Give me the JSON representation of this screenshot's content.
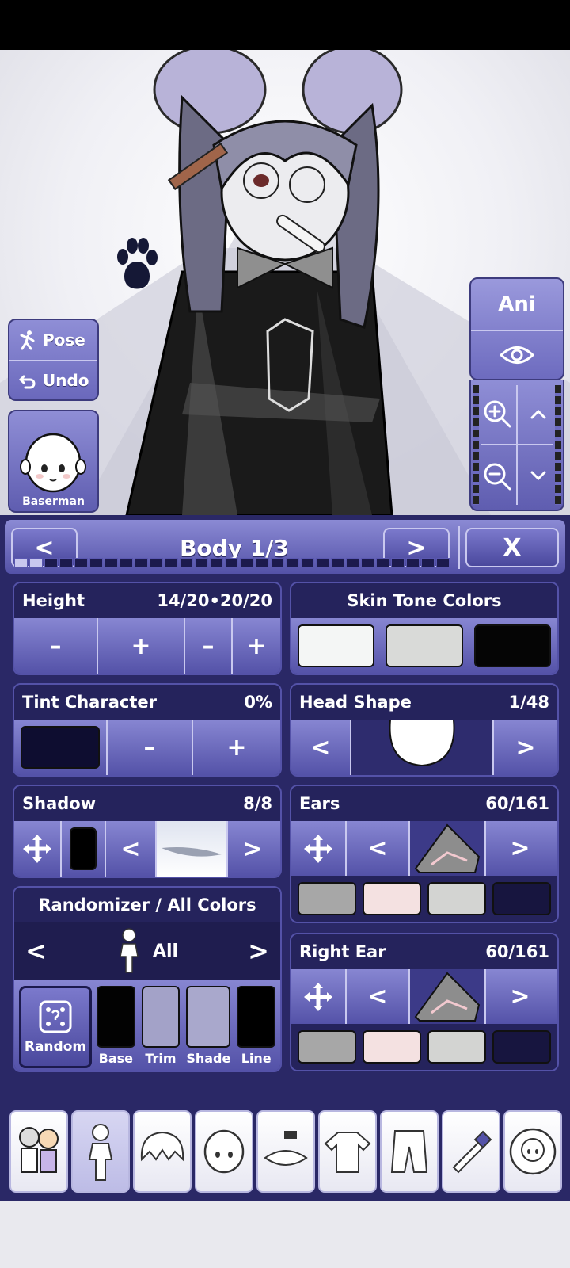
{
  "scene": {
    "pose_label": "Pose",
    "undo_label": "Undo",
    "preset_name": "Baserman",
    "ani_label": "Ani"
  },
  "panel": {
    "prev_label": "<",
    "title": "Body 1/3",
    "next_label": ">",
    "close_label": "X",
    "progress_total": 29,
    "progress_active": 2
  },
  "height": {
    "label": "Height",
    "value": "14/20•20/20",
    "minus": "–",
    "plus": "+"
  },
  "skin": {
    "label": "Skin Tone Colors",
    "colors": [
      "#f4f6f5",
      "#d9dad8",
      "#050505"
    ]
  },
  "tint": {
    "label": "Tint Character",
    "value": "0%",
    "color": "#0e0d30",
    "minus": "–",
    "plus": "+"
  },
  "head": {
    "label": "Head Shape",
    "value": "1/48",
    "prev": "<",
    "next": ">"
  },
  "shadow": {
    "label": "Shadow",
    "value": "8/8",
    "color": "#000000",
    "prev": "<",
    "next": ">"
  },
  "ears": {
    "label": "Ears",
    "value": "60/161",
    "prev": "<",
    "next": ">",
    "colors": [
      "#a7a7a7",
      "#f4e1e1",
      "#d3d4d2",
      "#17153f"
    ]
  },
  "randomizer": {
    "label": "Randomizer / All Colors",
    "mode": "All",
    "prev": "<",
    "next": ">",
    "random_label": "Random",
    "swatches": [
      {
        "label": "Base",
        "color": "#020202"
      },
      {
        "label": "Trim",
        "color": "#a3a2c8"
      },
      {
        "label": "Shade",
        "color": "#a9a8cc"
      },
      {
        "label": "Line",
        "color": "#000000"
      }
    ]
  },
  "right_ear": {
    "label": "Right Ear",
    "value": "60/161",
    "prev": "<",
    "next": ">",
    "colors": [
      "#a7a7a7",
      "#f4e1e1",
      "#d3d4d2",
      "#17153f"
    ]
  },
  "tabs": [
    "group-icon",
    "body-icon",
    "hair-icon",
    "face-icon",
    "accessory-icon",
    "top-icon",
    "bottom-icon",
    "props-icon",
    "profile-icon"
  ]
}
